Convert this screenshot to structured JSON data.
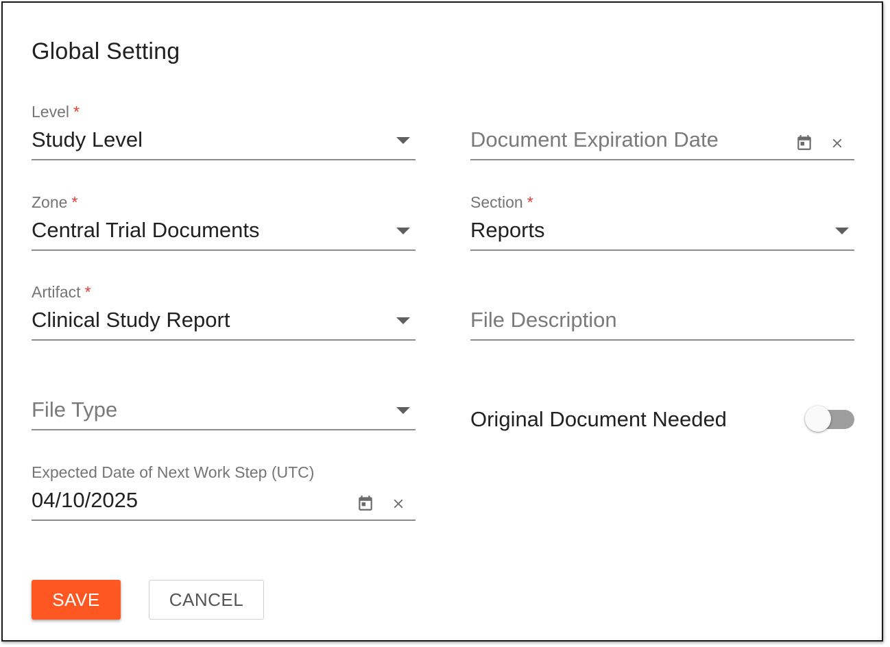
{
  "dialog": {
    "title": "Global Setting"
  },
  "form": {
    "level": {
      "label": "Level",
      "required_mark": "*",
      "value": "Study Level"
    },
    "expiration": {
      "placeholder": "Document Expiration Date"
    },
    "zone": {
      "label": "Zone",
      "required_mark": "*",
      "value": "Central Trial Documents"
    },
    "section": {
      "label": "Section",
      "required_mark": "*",
      "value": "Reports"
    },
    "artifact": {
      "label": "Artifact",
      "required_mark": "*",
      "value": "Clinical Study Report"
    },
    "file_description": {
      "placeholder": "File Description"
    },
    "file_type": {
      "placeholder": "File Type"
    },
    "original_needed": {
      "label": "Original Document Needed",
      "checked": false
    },
    "next_step_date": {
      "label": "Expected Date of Next Work Step (UTC)",
      "value": "04/10/2025"
    }
  },
  "actions": {
    "save_label": "SAVE",
    "cancel_label": "CANCEL"
  },
  "colors": {
    "accent": "#ff5722",
    "required": "#e53935"
  },
  "icons": {
    "dropdown": "caret-down-icon",
    "calendar": "calendar-icon",
    "clear": "close-icon"
  }
}
